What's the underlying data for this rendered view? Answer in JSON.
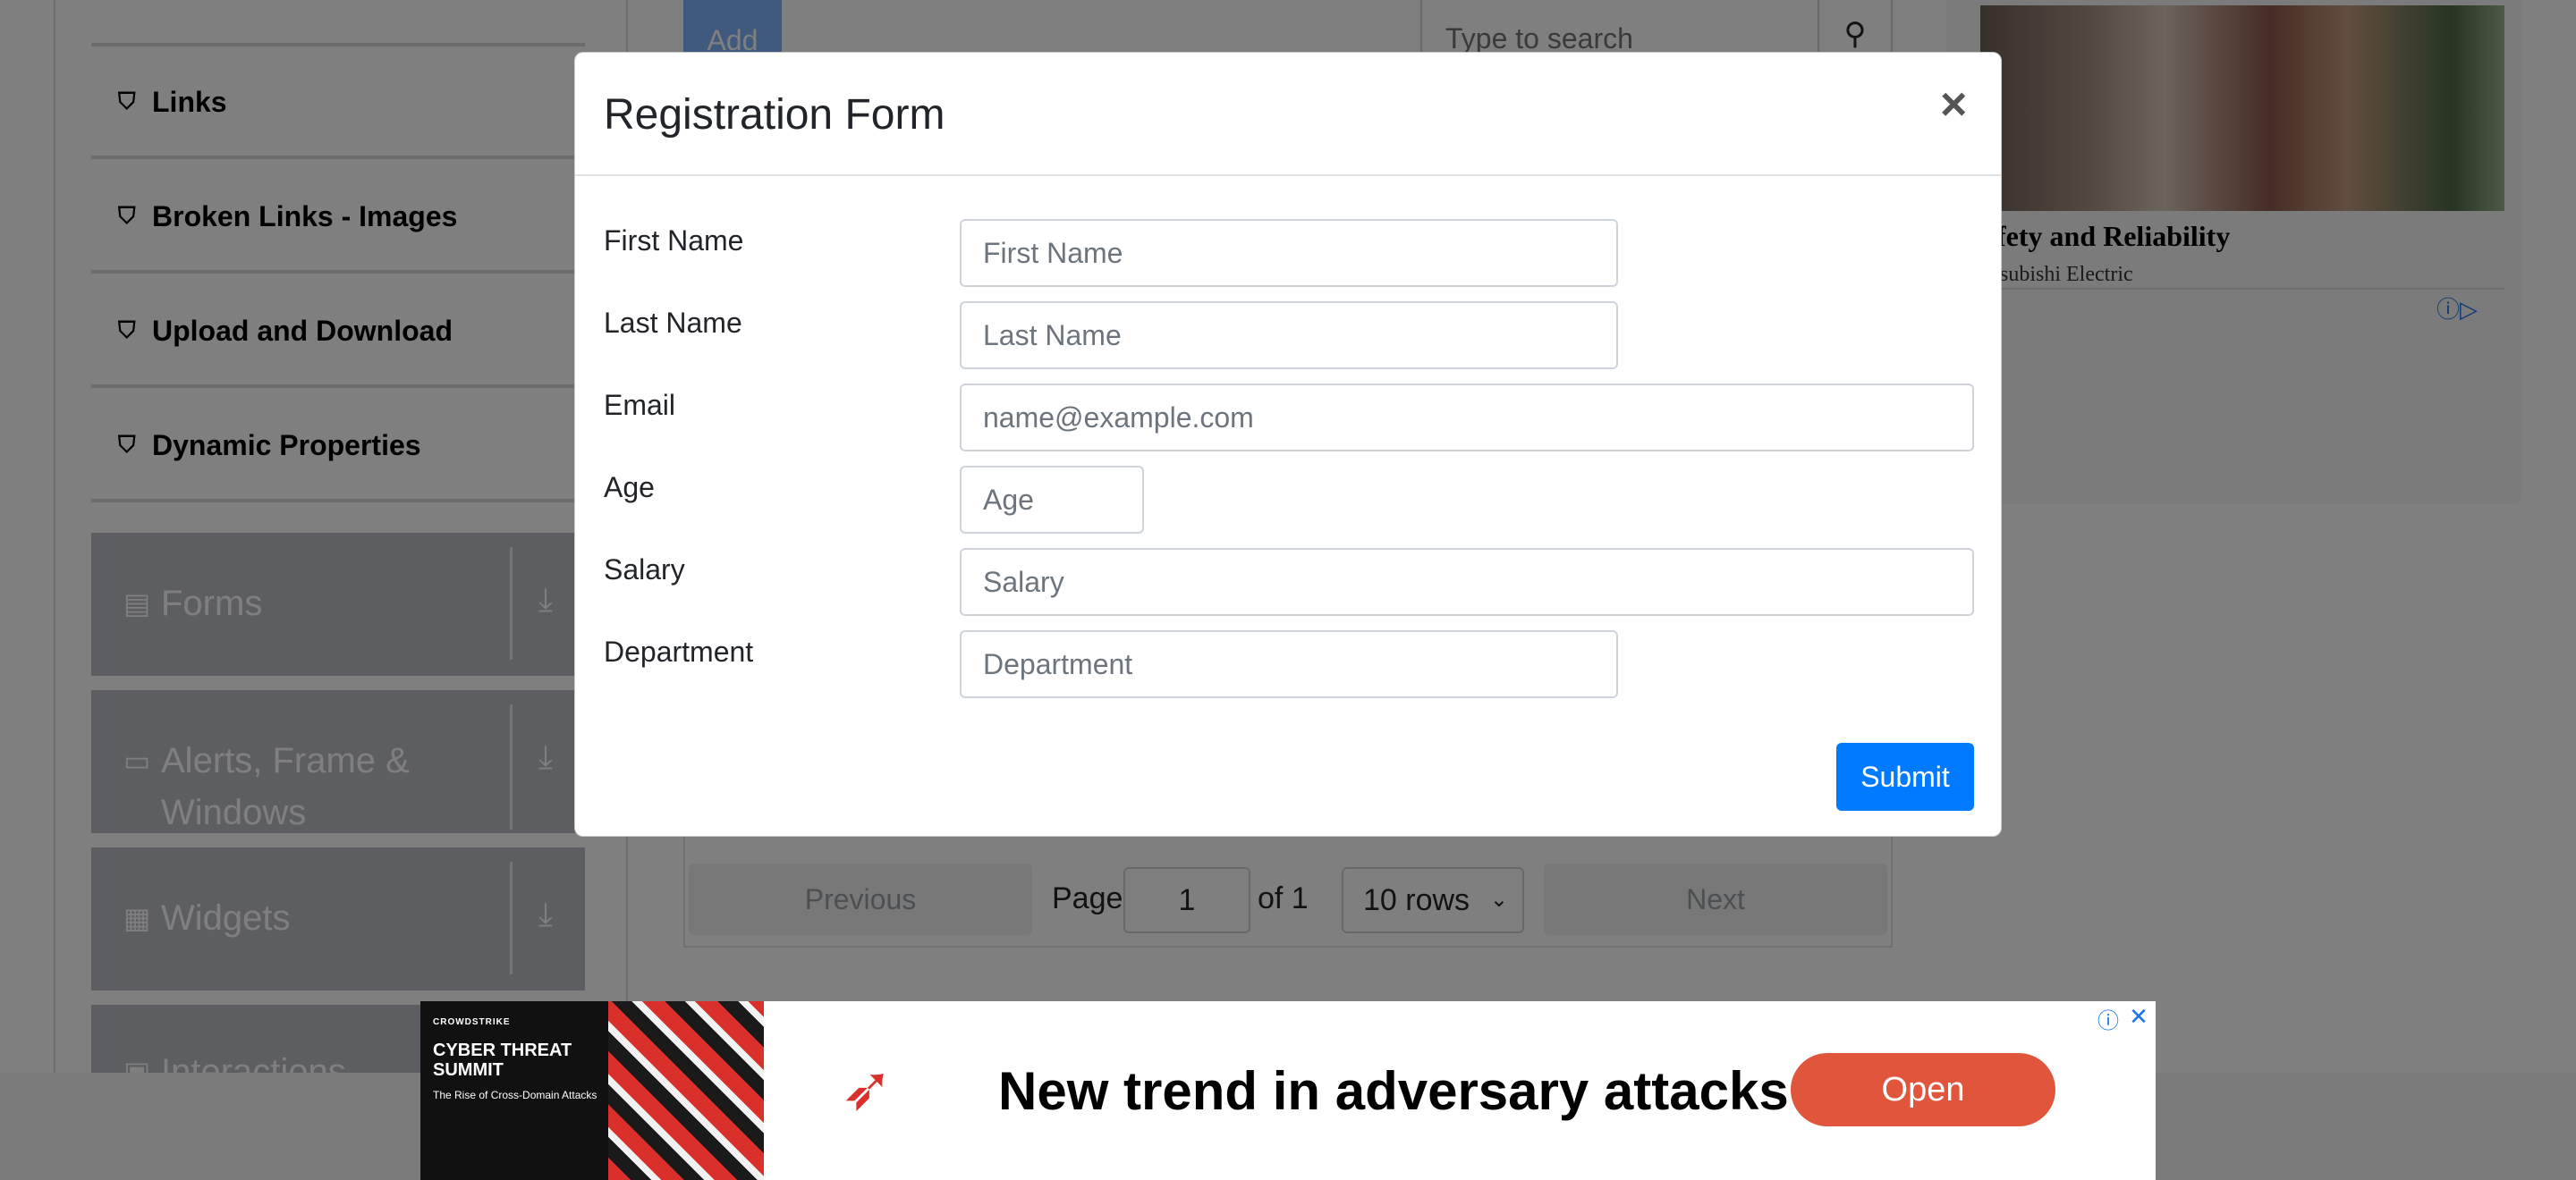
{
  "sidebar": {
    "elements_items": [
      {
        "label": "Links"
      },
      {
        "label": "Broken Links - Images"
      },
      {
        "label": "Upload and Download"
      },
      {
        "label": "Dynamic Properties"
      }
    ],
    "groups": [
      {
        "label": "Forms"
      },
      {
        "label": "Alerts, Frame & Windows"
      },
      {
        "label": "Widgets"
      },
      {
        "label": "Interactions"
      }
    ]
  },
  "toolbar": {
    "add_label": "Add",
    "search_placeholder": "Type to search"
  },
  "pagination": {
    "previous_label": "Previous",
    "page_label": "Page",
    "page_value": "1",
    "of_label": "of 1",
    "rows_label": "10 rows",
    "next_label": "Next"
  },
  "side_ad": {
    "headline": "afety and Reliability",
    "advertiser": "litsubishi Electric"
  },
  "modal": {
    "title": "Registration Form",
    "close_glyph": "×",
    "fields": [
      {
        "label": "First Name",
        "placeholder": "First Name"
      },
      {
        "label": "Last Name",
        "placeholder": "Last Name"
      },
      {
        "label": "Email",
        "placeholder": "name@example.com"
      },
      {
        "label": "Age",
        "placeholder": "Age"
      },
      {
        "label": "Salary",
        "placeholder": "Salary"
      },
      {
        "label": "Department",
        "placeholder": "Department"
      }
    ],
    "submit_label": "Submit"
  },
  "bottom_ad": {
    "brand": "CROWDSTRIKE",
    "thumb_title": "CYBER THREAT SUMMIT",
    "thumb_subtitle": "The Rise of Cross-Domain Attacks",
    "headline": "New trend in adversary attacks",
    "cta": "Open"
  },
  "colors": {
    "primary": "#007bff",
    "sidebar_group": "#b9bdc2",
    "ad_cta": "#e0553c"
  },
  "icons": {
    "sub_item_icon": "shield-icon",
    "close_icon": "close-icon",
    "search_icon": "search-icon",
    "download_icon": "download-arrow-icon"
  }
}
